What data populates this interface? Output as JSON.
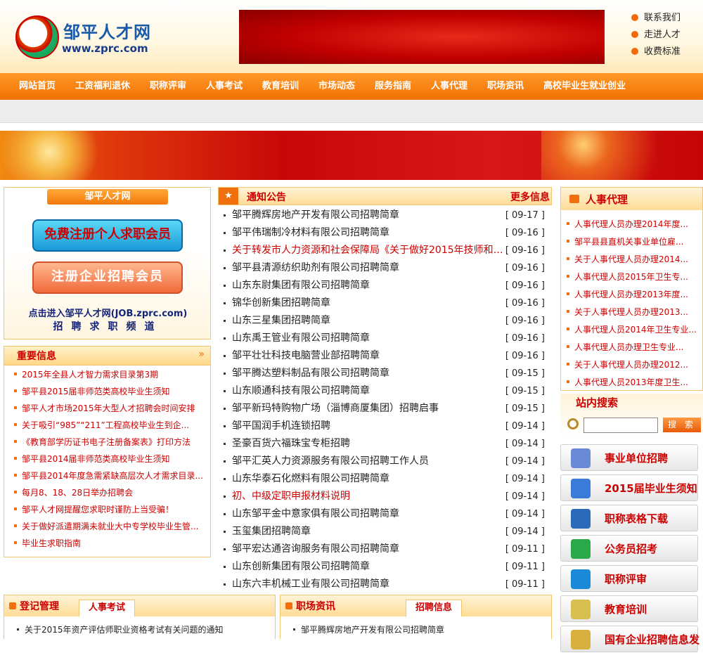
{
  "header": {
    "logo_cn": "邹平人才网",
    "logo_url": "www.zprc.com",
    "top_links": [
      "联系我们",
      "走进人才",
      "收费标准"
    ]
  },
  "nav": [
    "网站首页",
    "工资福利退休",
    "职称评审",
    "人事考试",
    "教育培训",
    "市场动态",
    "服务指南",
    "人事代理",
    "职场资讯",
    "高校毕业生就业创业"
  ],
  "register": {
    "title": "邹平人才网",
    "btn_personal": "免费注册个人求职会员",
    "btn_company": "注册企业招聘会员",
    "link": "点击进入邹平人才网(JOB.zprc.com)",
    "link2": "招聘求职频道"
  },
  "important": {
    "title": "重要信息",
    "arrow": "»",
    "items": [
      {
        "text": "2015年全县人才智力需求目录第3期",
        "red": true
      },
      {
        "text": "邹平县2015届非师范类高校毕业生须知",
        "red": true
      },
      {
        "text": "邹平人才市场2015年大型人才招聘会时间安排",
        "red": true
      },
      {
        "text": "关于吸引“985”“211”工程高校毕业生到企...",
        "red": true
      },
      {
        "text": "《教育部学历证书电子注册备案表》打印方法",
        "red": true
      },
      {
        "text": "邹平县2014届非师范类高校毕业生须知",
        "red": true
      },
      {
        "text": "邹平县2014年度急需紧缺高层次人才需求目录...",
        "red": true
      },
      {
        "text": "每月8、18、28日举办招聘会",
        "red": true
      },
      {
        "text": "邹平人才网提醒您求职时谨防上当受骗！",
        "red": true
      },
      {
        "text": "关于做好派遣期满未就业大中专学校毕业生管...",
        "red": true
      },
      {
        "text": "毕业生求职指南",
        "red": true
      }
    ]
  },
  "notice": {
    "title": "通知公告",
    "more": "更多信息",
    "star": "★",
    "items": [
      {
        "text": "邹平腾辉房地产开发有限公司招聘简章",
        "date": "[ 09-17 ]",
        "red": false
      },
      {
        "text": "邹平伟瑞制冷材料有限公司招聘简章",
        "date": "[ 09-16 ]",
        "red": false
      },
      {
        "text": "关于转发市人力资源和社会保障局《关于做好2015年技师和高...",
        "date": "[ 09-16 ]",
        "red": true
      },
      {
        "text": "邹平县清源纺织助剂有限公司招聘简章",
        "date": "[ 09-16 ]",
        "red": false
      },
      {
        "text": "山东东尉集团有限公司招聘简章",
        "date": "[ 09-16 ]",
        "red": false
      },
      {
        "text": "锦华创新集团招聘简章",
        "date": "[ 09-16 ]",
        "red": false
      },
      {
        "text": "山东三星集团招聘简章",
        "date": "[ 09-16 ]",
        "red": false
      },
      {
        "text": "山东禹王管业有限公司招聘简章",
        "date": "[ 09-16 ]",
        "red": false
      },
      {
        "text": "邹平壮壮科技电脑营业部招聘简章",
        "date": "[ 09-16 ]",
        "red": false
      },
      {
        "text": "邹平腾达塑料制品有限公司招聘简章",
        "date": "[ 09-15 ]",
        "red": false
      },
      {
        "text": "山东顺通科技有限公司招聘简章",
        "date": "[ 09-15 ]",
        "red": false
      },
      {
        "text": "邹平新玛特购物广场（淄博商厦集团）招聘启事",
        "date": "[ 09-15 ]",
        "red": false
      },
      {
        "text": "邹平国润手机连锁招聘",
        "date": "[ 09-14 ]",
        "red": false
      },
      {
        "text": "圣豪百货六福珠宝专柜招聘",
        "date": "[ 09-14 ]",
        "red": false
      },
      {
        "text": "邹平汇英人力资源服务有限公司招聘工作人员",
        "date": "[ 09-14 ]",
        "red": false
      },
      {
        "text": "山东华泰石化燃料有限公司招聘简章",
        "date": "[ 09-14 ]",
        "red": false
      },
      {
        "text": "初、中级定职申报材料说明",
        "date": "[ 09-14 ]",
        "red": true
      },
      {
        "text": "山东邹平金中意家俱有限公司招聘简章",
        "date": "[ 09-14 ]",
        "red": false
      },
      {
        "text": "玉玺集团招聘简章",
        "date": "[ 09-14 ]",
        "red": false
      },
      {
        "text": "邹平宏达通咨询服务有限公司招聘简章",
        "date": "[ 09-11 ]",
        "red": false
      },
      {
        "text": "山东创新集团有限公司招聘简章",
        "date": "[ 09-11 ]",
        "red": false
      },
      {
        "text": "山东六丰机械工业有限公司招聘简章",
        "date": "[ 09-11 ]",
        "red": false
      }
    ]
  },
  "agency": {
    "title": "人事代理",
    "items": [
      "人事代理人员办理2014年度...",
      "邹平县县直机关事业单位雇...",
      "关于人事代理人员办理2014...",
      "人事代理人员2015年卫生专...",
      "人事代理人员办理2013年度...",
      "关于人事代理人员办理2013...",
      "人事代理人员2014年卫生专业...",
      "人事代理人员办理卫生专业...",
      "关于人事代理人员办理2012...",
      "人事代理人员2013年度卫生..."
    ]
  },
  "search": {
    "title": "站内搜索",
    "button": "搜 索",
    "value": ""
  },
  "quick": [
    {
      "label": "事业单位招聘",
      "icon": "document-pen-icon",
      "color": "#6a8ad8"
    },
    {
      "label": "2015届毕业生须知",
      "icon": "document-icon",
      "color": "#3a7ad8"
    },
    {
      "label": "职称表格下载",
      "icon": "computer-icon",
      "color": "#2a6ab8"
    },
    {
      "label": "公务员招考",
      "icon": "people-icon",
      "color": "#2aa84a"
    },
    {
      "label": "职称评审",
      "icon": "globe-icon",
      "color": "#1a8ad8"
    },
    {
      "label": "教育培训",
      "icon": "clipboard-icon",
      "color": "#d8c050"
    },
    {
      "label": "国有企业招聘信息发",
      "icon": "folder-icon",
      "color": "#d8b040"
    }
  ],
  "bottom_left": {
    "title": "登记管理",
    "tab": "人事考试",
    "item": "关于2015年资产评估师职业资格考试有关问题的通知"
  },
  "bottom_right": {
    "title": "职场资讯",
    "tab": "招聘信息",
    "item": "邹平腾辉房地产开发有限公司招聘简章"
  }
}
